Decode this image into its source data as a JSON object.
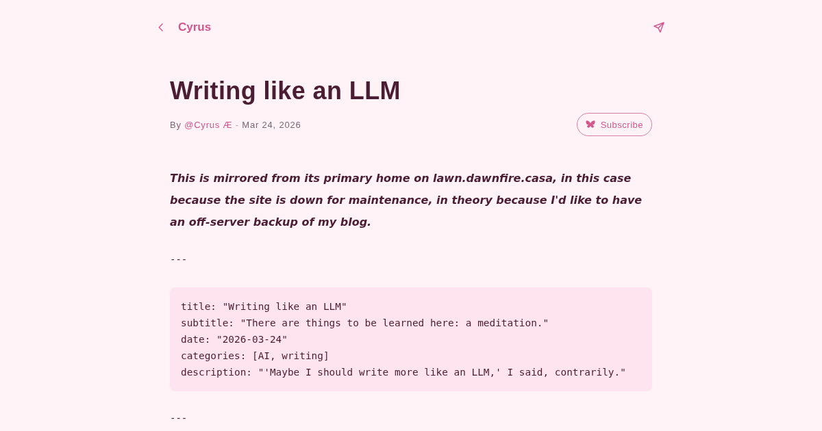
{
  "nav": {
    "site_name": "Cyrus"
  },
  "post": {
    "title": "Writing like an LLM",
    "byline": {
      "prefix": "By",
      "author": "@Cyrus Æ",
      "separator": "-",
      "date": "Mar 24, 2026"
    },
    "subscribe_button": {
      "label": "Subscribe"
    }
  },
  "intro": "This is mirrored from its primary home on lawn.dawnfire.casa, in this case because the site is down for maintenance, in theory because I'd like to have an off-server backup of my blog.",
  "sections": [
    {
      "kind": "rule",
      "text": "---"
    },
    {
      "kind": "code",
      "lines": [
        "title: \"Writing like an LLM\"",
        "subtitle: \"There are things to be learned here: a meditation.\"",
        "date: \"2026-03-24\"",
        "categories: [AI, writing]",
        "description: \"'Maybe I should write more like an LLM,' I said, contrarily.\""
      ]
    },
    {
      "kind": "rule",
      "text": "---"
    }
  ]
}
